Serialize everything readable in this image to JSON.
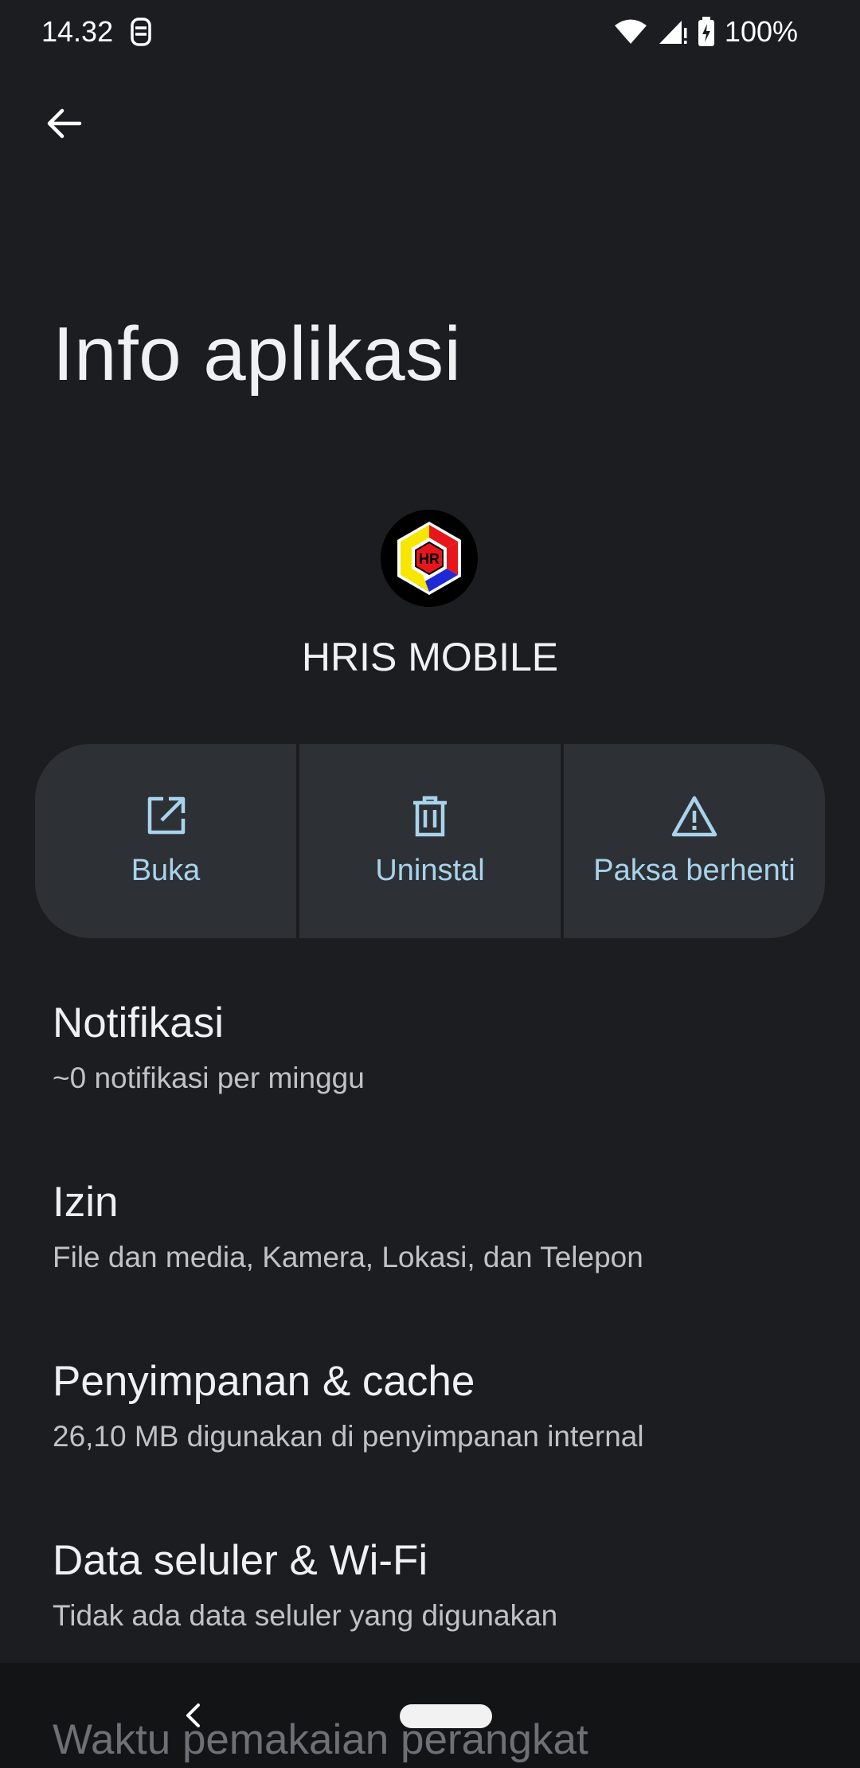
{
  "status_bar": {
    "time": "14.32",
    "battery": "100%"
  },
  "header": {
    "title": "Info aplikasi"
  },
  "app": {
    "name": "HRIS MOBILE",
    "icon_badge": "HR"
  },
  "actions": [
    {
      "label": "Buka",
      "icon": "open-in-new-icon"
    },
    {
      "label": "Uninstal",
      "icon": "trash-icon"
    },
    {
      "label": "Paksa berhenti",
      "icon": "warning-icon"
    }
  ],
  "settings": [
    {
      "title": "Notifikasi",
      "subtitle": "~0 notifikasi per minggu"
    },
    {
      "title": "Izin",
      "subtitle": "File dan media, Kamera, Lokasi, dan Telepon"
    },
    {
      "title": "Penyimpanan & cache",
      "subtitle": "26,10 MB digunakan di penyimpanan internal"
    },
    {
      "title": "Data seluler & Wi-Fi",
      "subtitle": "Tidak ada data seluler yang digunakan"
    },
    {
      "title": "Waktu pemakaian perangkat"
    }
  ],
  "colors": {
    "background": "#1b1d20",
    "action_bg": "#2d3135",
    "accent": "#a9d3ec"
  }
}
